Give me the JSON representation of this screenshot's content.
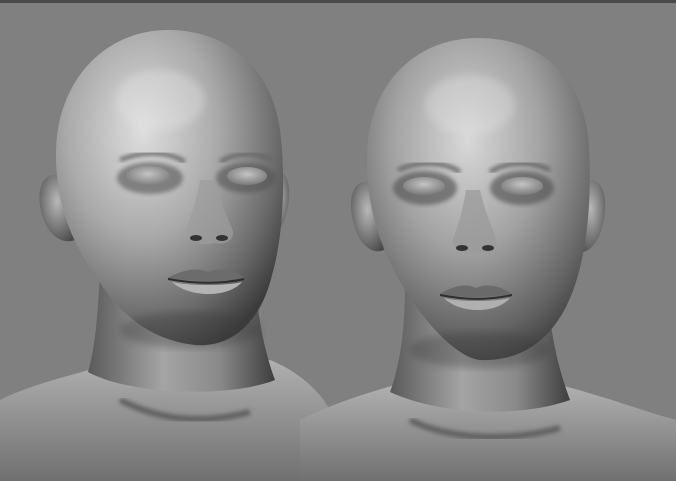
{
  "scene": {
    "background_color": "#808080",
    "top_edge_color": "#4a4a4a",
    "models": [
      {
        "name": "bust-front-view",
        "view": "front"
      },
      {
        "name": "bust-three-quarter-view",
        "view": "three-quarter"
      }
    ],
    "material": {
      "highlight_color": "#dcdcdc",
      "mid_color": "#9a9a9a",
      "shadow_color": "#2a2a2a"
    }
  }
}
